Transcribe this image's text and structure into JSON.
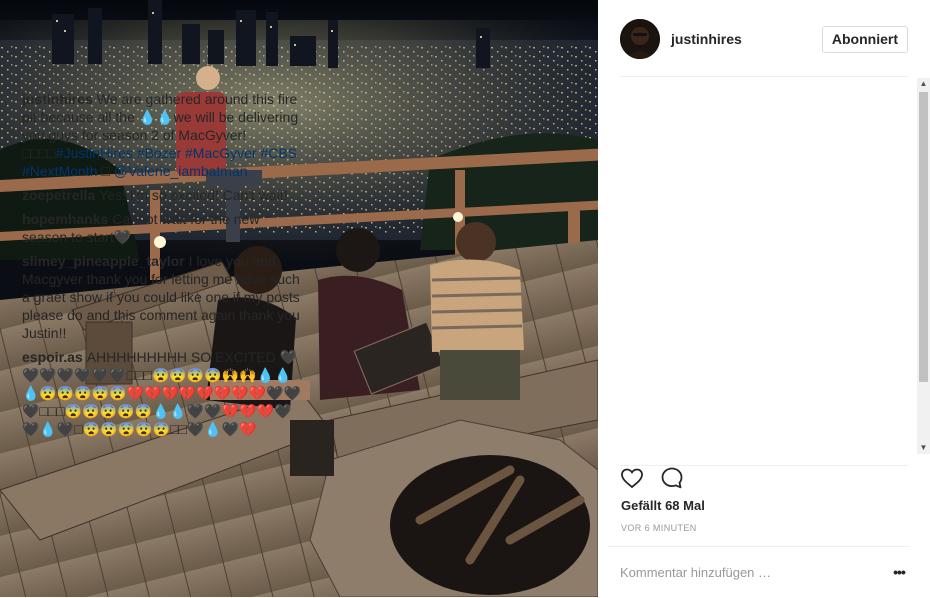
{
  "post": {
    "username": "justinhires",
    "follow_label": "Abonniert",
    "likes": "Gefällt 68 Mal",
    "timestamp": "VOR 6 MINUTEN",
    "comment_placeholder": "Kommentar hinzufügen …",
    "more_label": "•••"
  },
  "caption": {
    "author": "justinhires",
    "text_1": "We are gathered around this fire pit because all the 💧💧we will be delivering you guys for season 2 of MacGyver!□□□□",
    "tag_1": "#JustinHires",
    "tag_2": "#Bozer",
    "tag_3": "#MacGyver",
    "tag_4": "#CBS",
    "tag_5": "#NextMonth",
    "text_2": "□",
    "mention": "@Valerie_iambatman"
  },
  "comments": [
    {
      "author": "zoepetrella",
      "text": "Yes! I'm so excited! Can't wait!"
    },
    {
      "author": "hopemhanks",
      "text": "Cannot wait for the new season to start🖤"
    },
    {
      "author": "slimey_pineapple_taylor",
      "text": "I love you and Macgyver thank you for letting me have such a graet show if you could like one if my posts please do and this comment again thank you Justin!!"
    },
    {
      "author": "espoir.as",
      "text": "AHHHHHHHHH SO EXCITED 🖤🖤🖤🖤🖤🖤🖤□□□😨😨😨😨🙌🙌💧💧💧😨😨😨😨😨💔💔💔💔💔💔💔💔🖤🖤🖤□□□😨😨😨😨😨💧💧🖤🖤💔💔💔🖤🖤💧🖤□😨😨😨😨😨□□🖤💧🖤💔"
    }
  ],
  "icons": {
    "like": "heart-outline-icon",
    "comment": "speech-bubble-icon",
    "more": "ellipsis-icon"
  },
  "colors": {
    "text": "#262626",
    "link": "#003569",
    "muted": "#999999",
    "border": "#dbdbdb"
  }
}
